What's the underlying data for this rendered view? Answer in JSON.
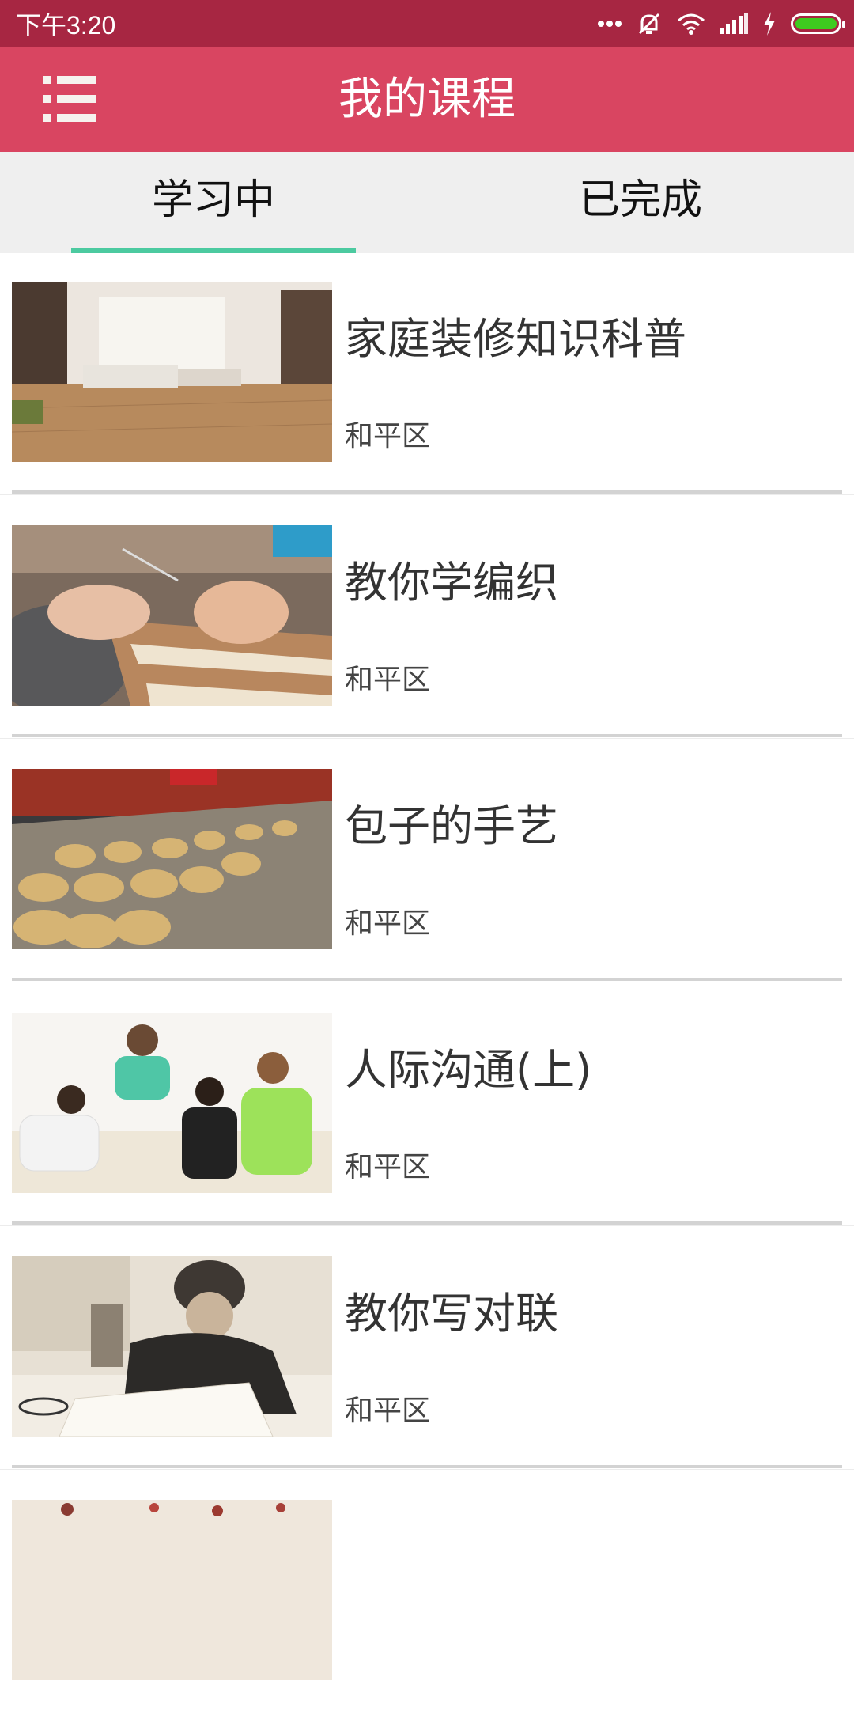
{
  "status_bar": {
    "time": "下午3:20",
    "icons": [
      "more-dots-icon",
      "mute-icon",
      "wifi-icon",
      "signal-icon",
      "charging-icon",
      "battery-icon"
    ],
    "background": "#a72642"
  },
  "app_bar": {
    "menu_icon": "menu-list-icon",
    "title": "我的课程",
    "background": "#d94561"
  },
  "tabs": {
    "items": [
      {
        "label": "学习中",
        "selected": true
      },
      {
        "label": "已完成",
        "selected": false
      }
    ],
    "indicator_color": "#4ccaa0"
  },
  "courses": [
    {
      "title": "家庭装修知识科普",
      "region": "和平区",
      "thumbnail": "living-room-photo"
    },
    {
      "title": "教你学编织",
      "region": "和平区",
      "thumbnail": "knitting-photo"
    },
    {
      "title": "包子的手艺",
      "region": "和平区",
      "thumbnail": "steamed-buns-photo"
    },
    {
      "title": "人际沟通(上)",
      "region": "和平区",
      "thumbnail": "group-conversation-photo"
    },
    {
      "title": "教你写对联",
      "region": "和平区",
      "thumbnail": "writing-elder-photo"
    }
  ]
}
